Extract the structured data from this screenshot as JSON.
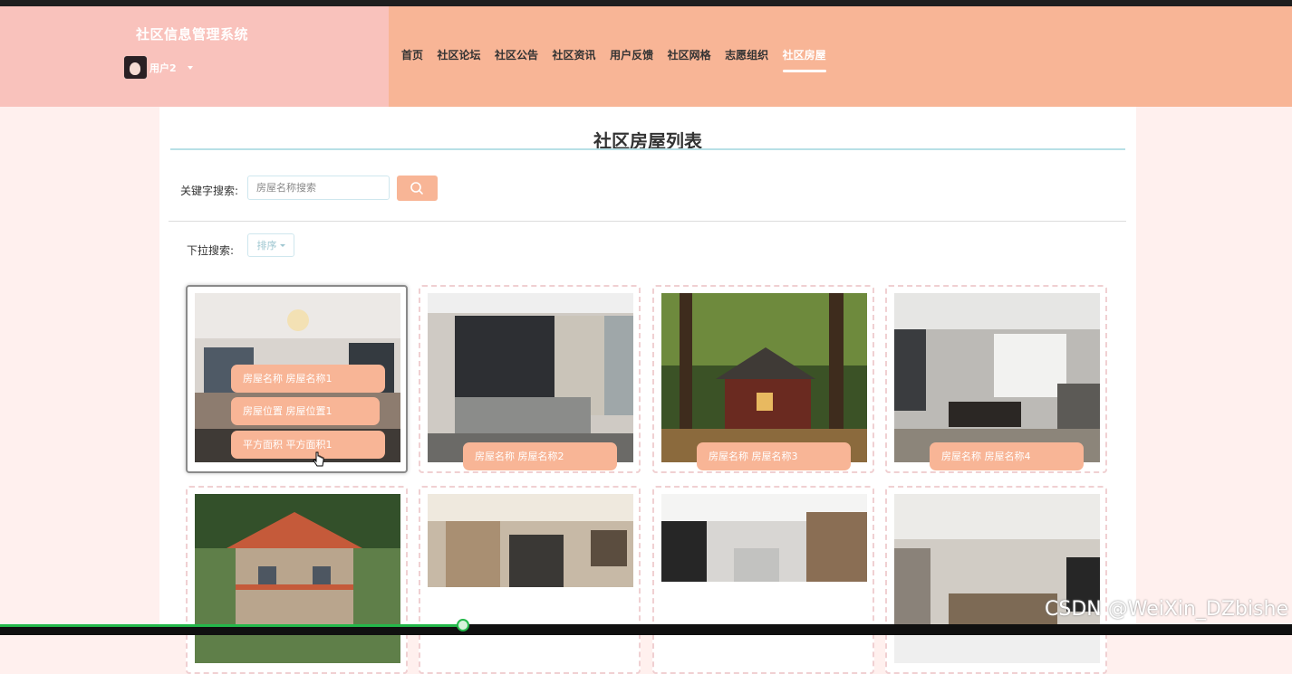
{
  "header": {
    "site_title": "社区信息管理系统",
    "user_name": "用户2"
  },
  "nav": {
    "items": [
      "首页",
      "社区论坛",
      "社区公告",
      "社区资讯",
      "用户反馈",
      "社区网格",
      "志愿组织",
      "社区房屋"
    ],
    "active": "社区房屋"
  },
  "page": {
    "title": "社区房屋列表",
    "keyword_label": "关键字搜索:",
    "search_placeholder": "房屋名称搜索",
    "dropdown_label": "下拉搜索:",
    "sort_label": "排序"
  },
  "cards": [
    {
      "pills": [
        "房屋名称  房屋名称1",
        "房屋位置  房屋位置1",
        "平方面积  平方面积1"
      ],
      "hovered": true
    },
    {
      "pills": [
        "房屋名称  房屋名称2"
      ]
    },
    {
      "pills": [
        "房屋名称  房屋名称3"
      ]
    },
    {
      "pills": [
        "房屋名称  房屋名称4"
      ]
    },
    {
      "pills": []
    },
    {
      "pills": []
    },
    {
      "pills": []
    },
    {
      "pills": []
    }
  ],
  "watermark": "CSDN @WeiXin_DZbishe",
  "colors": {
    "accent": "#f8b596",
    "header_left": "#f9c2bc",
    "page_bg": "#fff0ee"
  }
}
